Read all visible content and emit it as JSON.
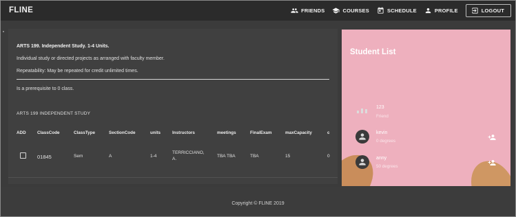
{
  "app": {
    "brand": "FLINE"
  },
  "nav": {
    "friends": "FRIENDS",
    "courses": "COURSES",
    "schedule": "SCHEDULE",
    "profile": "PROFILE",
    "logout": "LOGOUT"
  },
  "course": {
    "title": "ARTS 199. Independent Study. 1-4 Units.",
    "description": "Individual study or directed projects as arranged with faculty member.",
    "repeatability": "Repeatability: May be repeated for credit unlimited times.",
    "prerequisite": "Is a prerequisite to 0 class.",
    "section_title": "ARTS 199 INDEPENDENT STUDY"
  },
  "table": {
    "headers": [
      "ADD",
      "ClassCode",
      "ClassType",
      "SectionCode",
      "units",
      "Instructors",
      "meetings",
      "FinalExam",
      "maxCapacity",
      "c"
    ],
    "rows": [
      {
        "add_checked": false,
        "classcode": "01845",
        "classtype": "Sem",
        "sectioncode": "A",
        "units": "1-4",
        "instructors": "TERRICCIANO, A.",
        "meetings": "TBA TBA",
        "finalexam": "TBA",
        "maxcapacity": "15",
        "c": "0"
      }
    ]
  },
  "student_list": {
    "title": "Student List",
    "friends": [
      {
        "name": "123",
        "status": "Friend"
      },
      {
        "name": "kevin",
        "status": "0 degrees"
      },
      {
        "name": "anny",
        "status": "50 degrees"
      }
    ]
  },
  "footer": {
    "copyright": "Copyright © FLINE 2019"
  },
  "colors": {
    "topbar": "#2b2b2b",
    "panel": "#eeb0be",
    "background": "#3b3b3b"
  },
  "icons": [
    "friends-icon",
    "courses-icon",
    "schedule-icon",
    "profile-icon",
    "logout-icon",
    "person-icon",
    "person-add-icon"
  ]
}
